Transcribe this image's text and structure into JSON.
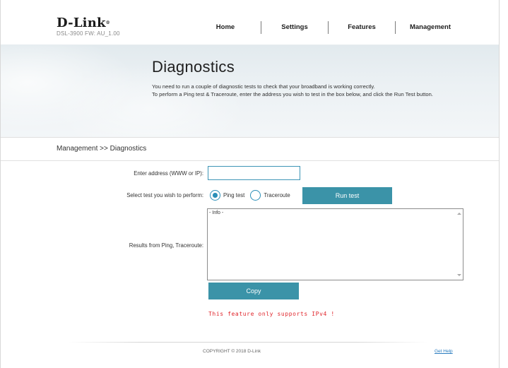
{
  "header": {
    "brand": "D-Link",
    "brand_mark": "®",
    "model_fw": "DSL-3900  FW: AU_1.00",
    "nav": [
      {
        "label": "Home"
      },
      {
        "label": "Settings"
      },
      {
        "label": "Features"
      },
      {
        "label": "Management"
      }
    ]
  },
  "banner": {
    "title": "Diagnostics",
    "description_line1": "You need to run a couple of diagnostic tests to check that your broadband is working correctly.",
    "description_line2": "To perform a Ping test & Traceroute, enter the address you wish to test in the box below, and click the Run Test button."
  },
  "breadcrumb": "Management >> Diagnostics",
  "form": {
    "address_label": "Enter address (WWW or IP):",
    "address_value": "",
    "test_label": "Select test you wish to perform:",
    "options": [
      {
        "label": "Ping test",
        "selected": true
      },
      {
        "label": "Traceroute",
        "selected": false
      }
    ],
    "run_button": "Run test",
    "results_label": "Results from Ping, Traceroute:",
    "results_text": "- Info -",
    "copy_button": "Copy",
    "warning": "This feature only supports IPv4 !"
  },
  "footer": {
    "copyright": "COPYRIGHT © 2018 D-Link",
    "help_link": "Get Help"
  },
  "colors": {
    "accent_button": "#3b93a8",
    "radio": "#2a8fb8",
    "warning": "#e0262c",
    "link": "#2a7cbf"
  }
}
